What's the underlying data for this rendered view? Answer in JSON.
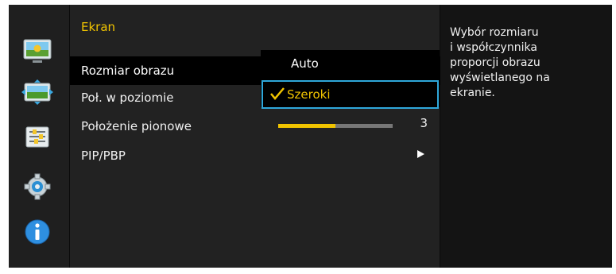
{
  "left_rail": {
    "icons": [
      {
        "name": "picture-icon",
        "active": false
      },
      {
        "name": "onscreen-display-icon",
        "active": true
      },
      {
        "name": "system-settings-icon",
        "active": false
      },
      {
        "name": "gear-icon",
        "active": false
      },
      {
        "name": "info-icon",
        "active": false
      }
    ]
  },
  "menu": {
    "title": "Ekran",
    "items": [
      {
        "label": "Rozmiar obrazu"
      },
      {
        "label": "Poł. w poziomie"
      },
      {
        "label": "Położenie pionowe"
      },
      {
        "label": "PIP/PBP"
      }
    ]
  },
  "dropdown": {
    "options": [
      {
        "label": "Auto",
        "selected": false
      },
      {
        "label": "Szeroki",
        "selected": true
      }
    ]
  },
  "vertical_position": {
    "value": "3",
    "level": 0.5
  },
  "help_text": {
    "line1": "Wybór rozmiaru",
    "line2": "i współczynnika",
    "line3": "proporcji obrazu",
    "line4": "wyświetlanego na",
    "line5": "ekranie."
  },
  "colors": {
    "accent_yellow": "#f1c400",
    "focus_blue": "#2fa7da"
  }
}
